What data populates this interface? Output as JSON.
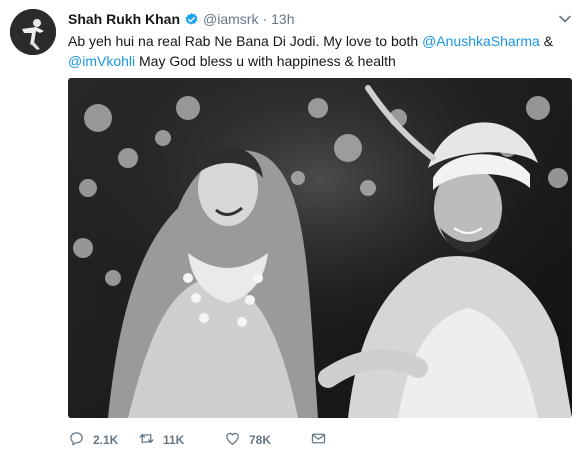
{
  "tweet": {
    "author_name": "Shah Rukh Khan",
    "handle": "@iamsrk",
    "separator": "·",
    "time": "13h",
    "text_part1": "Ab yeh hui na real Rab Ne Bana Di Jodi. My love to both ",
    "mention1": "@AnushkaSharma",
    "text_part2": " & ",
    "mention2": "@imVkohli",
    "text_part3": " May God bless u with happiness & health",
    "photo_alt": "Wedding photo of Anushka Sharma and Virat Kohli"
  },
  "actions": {
    "replies": "2.1K",
    "retweets": "11K",
    "likes": "78K"
  },
  "colors": {
    "link": "#1b95e0",
    "verified": "#1da1f2",
    "muted": "#657786",
    "text": "#14171a"
  },
  "icons": [
    "verified-badge-icon",
    "chevron-down-icon",
    "reply-icon",
    "retweet-icon",
    "like-icon",
    "direct-message-icon"
  ]
}
